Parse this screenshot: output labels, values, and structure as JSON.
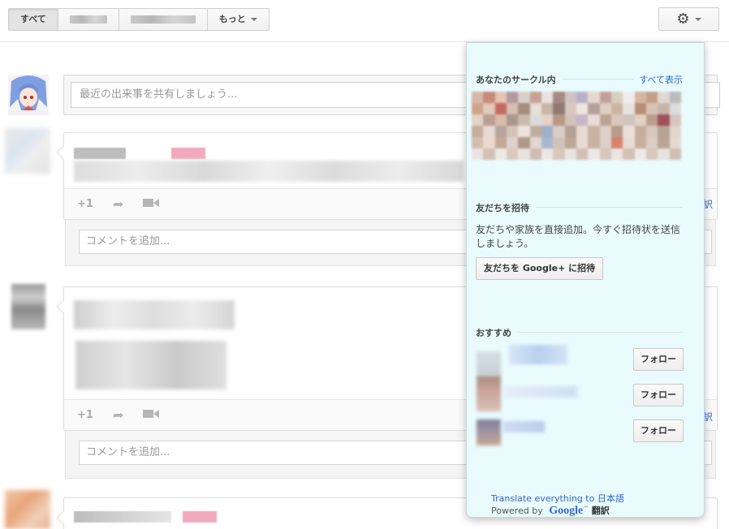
{
  "topbar": {
    "filters": {
      "all_label": "すべて",
      "more_label": "もっと"
    }
  },
  "share": {
    "placeholder": "最近の出来事を共有しましょう..."
  },
  "posts": [
    {
      "action_plus": "+1",
      "comment_placeholder": "コメントを追加...",
      "right_fragment": "訳"
    },
    {
      "action_plus": "+1",
      "comment_placeholder": "コメントを追加...",
      "right_fragment": "訳"
    }
  ],
  "panel": {
    "circles_title": "あなたのサークル内",
    "view_all": "すべて表示",
    "invite_title": "友だちを招待",
    "invite_text": "友だちや家族を直接追加。今すぐ招待状を送信しましょう。",
    "invite_button": "友だちを Google+ に招待",
    "suggested_title": "おすすめ",
    "follow_label": "フォロー",
    "translate_prefix": "Translate everything to ",
    "translate_language": "日本語",
    "powered_by": "Powered by",
    "brand": "Google",
    "translate_label": "翻訳"
  },
  "colors": {
    "panel_bg": "#e9fbfd",
    "link": "#3366cc"
  },
  "icons": {
    "gear": "gear-icon",
    "share": "share-arrow-icon",
    "video": "video-camera-icon"
  }
}
